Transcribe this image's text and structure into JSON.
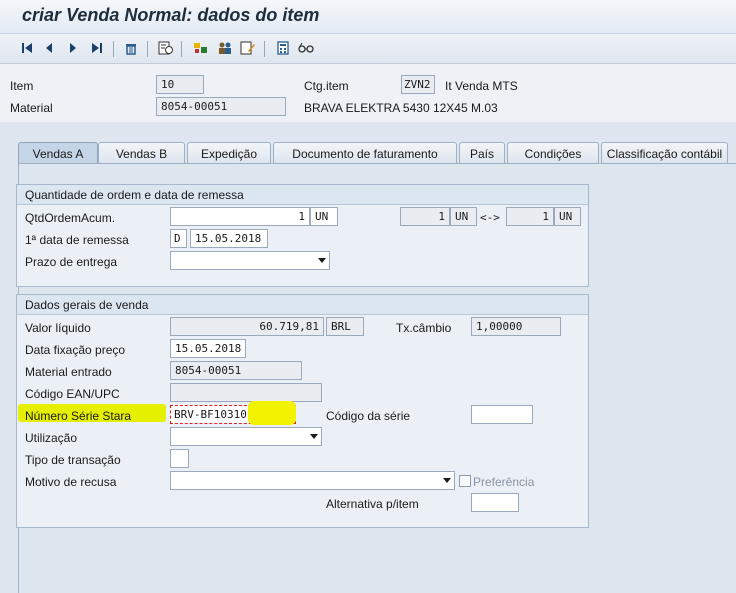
{
  "window": {
    "title": "criar Venda Normal: dados do item"
  },
  "toolbar": {
    "icons": [
      "first-page-icon",
      "previous-page-icon",
      "next-page-icon",
      "last-page-icon",
      "delete-icon",
      "details-icon",
      "item-icon",
      "partner-icon",
      "edit-icon",
      "calculator-icon",
      "glasses-icon"
    ]
  },
  "header": {
    "item_label": "Item",
    "item_value": "10",
    "material_label": "Material",
    "material_value": "8054-00051",
    "ctg_label": "Ctg.item",
    "ctg_value": "ZVN2",
    "ctg_text": "It Venda MTS",
    "material_desc": "BRAVA ELEKTRA 5430 12X45 M.03"
  },
  "tabs": [
    {
      "label": "Vendas A",
      "active": true
    },
    {
      "label": "Vendas B"
    },
    {
      "label": "Expedição"
    },
    {
      "label": "Documento de faturamento"
    },
    {
      "label": "País"
    },
    {
      "label": "Condições"
    },
    {
      "label": "Classificação contábil"
    }
  ],
  "group1": {
    "title": "Quantidade de ordem e data de remessa",
    "qtd_label": "QtdOrdemAcum.",
    "qtd_value": "1",
    "qtd_unit": "UN",
    "qtd2_value": "1",
    "qtd2_unit": "UN",
    "arrow": "<->",
    "qtd3_value": "1",
    "qtd3_unit": "UN",
    "data_label": "1ª data de remessa",
    "data_type": "D",
    "data_value": "15.05.2018",
    "prazo_label": "Prazo de entrega",
    "prazo_value": ""
  },
  "group2": {
    "title": "Dados gerais de venda",
    "valor_label": "Valor líquido",
    "valor_value": "60.719,81",
    "valor_currency": "BRL",
    "cambio_label": "Tx.câmbio",
    "cambio_value": "1,00000",
    "fixacao_label": "Data fixação preço",
    "fixacao_value": "15.05.2018",
    "matent_label": "Material entrado",
    "matent_value": "8054-00051",
    "ean_label": "Código EAN/UPC",
    "ean_value": "",
    "serie_label": "Número Série Stara",
    "serie_value": "BRV-BF10310",
    "codserie_label": "Código da série",
    "codserie_value": "",
    "util_label": "Utilização",
    "util_value": "",
    "tipo_label": "Tipo de transação",
    "tipo_value": "",
    "motivo_label": "Motivo de recusa",
    "motivo_value": "",
    "preferencia_label": "Preferência",
    "alternativa_label": "Alternativa p/item",
    "alternativa_value": ""
  },
  "colors": {
    "accent": "#1b3f6b",
    "highlight": "#e5ef00",
    "error_border": "#e02020"
  }
}
